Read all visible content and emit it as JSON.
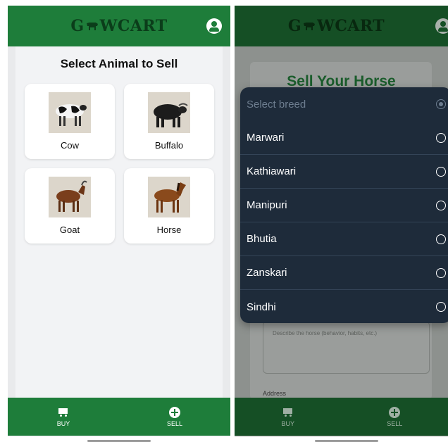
{
  "left": {
    "app_title": "GCOWCART",
    "logo_prefix": "G",
    "logo_suffix": "WCART",
    "section_title": "Select Animal to Sell",
    "animals": [
      {
        "label": "Cow",
        "icon": "cow-photo"
      },
      {
        "label": "Buffalo",
        "icon": "buffalo-photo"
      },
      {
        "label": "Goat",
        "icon": "goat-photo"
      },
      {
        "label": "Horse",
        "icon": "horse-photo"
      }
    ],
    "nav": {
      "buy_label": "BUY",
      "sell_label": "SELL"
    }
  },
  "right": {
    "logo_prefix": "G",
    "logo_suffix": "WCART",
    "sell_title": "Sell Your Horse",
    "breed_sheet": {
      "placeholder": "Select breed",
      "options": [
        "Marwari",
        "Kathiawari",
        "Manipuri",
        "Bhutia",
        "Zanskari",
        "Sindhi"
      ]
    },
    "description_placeholder": "Describe the horse (behavior, habits, etc.)",
    "address_label": "Address",
    "nav": {
      "buy_label": "BUY",
      "sell_label": "SELL"
    }
  },
  "colors": {
    "brand_green": "#1e7d3a",
    "sheet_bg": "#1e2b3a",
    "title_green": "#1a5c2b"
  }
}
